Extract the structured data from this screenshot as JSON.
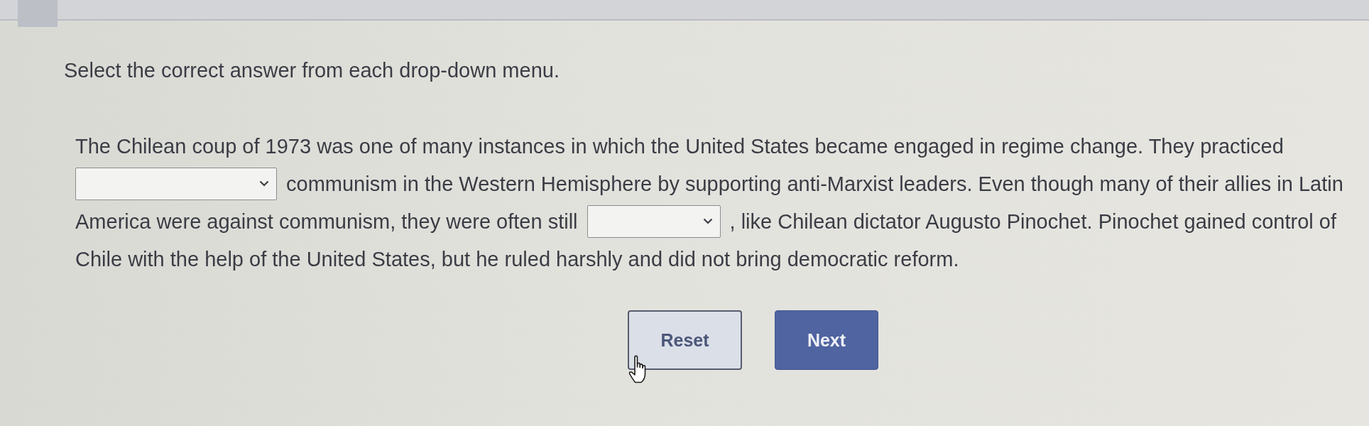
{
  "instruction": "Select the correct answer from each drop-down menu.",
  "passage": {
    "lines": [
      {
        "segments": [
          {
            "kind": "text",
            "text": "The Chilean coup of 1973 was one of many instances in which the United States became engaged in regime change. They practiced"
          }
        ]
      },
      {
        "segments": [
          {
            "kind": "dropdown"
          },
          {
            "kind": "text",
            "text": "communism in the Western Hemisphere by supporting anti-Marxist leaders. Even though many of their allies in Latin"
          }
        ]
      },
      {
        "segments": [
          {
            "kind": "text",
            "text": "America were against communism, they were often still"
          },
          {
            "kind": "dropdown"
          },
          {
            "kind": "text",
            "text": ", like Chilean dictator Augusto Pinochet. Pinochet gained control of"
          }
        ]
      },
      {
        "segments": [
          {
            "kind": "text",
            "text": "Chile with the help of the United States, but he ruled harshly and did not bring democratic reform."
          }
        ]
      }
    ]
  },
  "buttons": [
    {
      "label": "Reset",
      "kind": "secondary"
    },
    {
      "label": "Next",
      "kind": "primary"
    }
  ]
}
